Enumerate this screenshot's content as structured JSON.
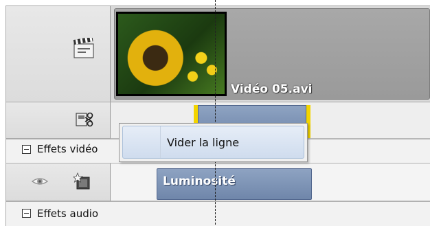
{
  "video_track": {
    "icon": "clapperboard-icon",
    "clip_title": "Vidéo 05.avi"
  },
  "split_lane": {
    "icon": "scissors-icon"
  },
  "context_menu": {
    "item_label": "Vider la ligne"
  },
  "video_effects": {
    "section_label": "Effets vidéo",
    "visibility_icon": "eye-icon",
    "fx_icon": "effect-star-icon",
    "clip_label": "Luminosité"
  },
  "audio_effects": {
    "section_label": "Effets audio"
  },
  "colors": {
    "clip_blue": "#7088ad",
    "trim_yellow": "#f2d400",
    "video_clip_gray": "#9e9e9e"
  }
}
